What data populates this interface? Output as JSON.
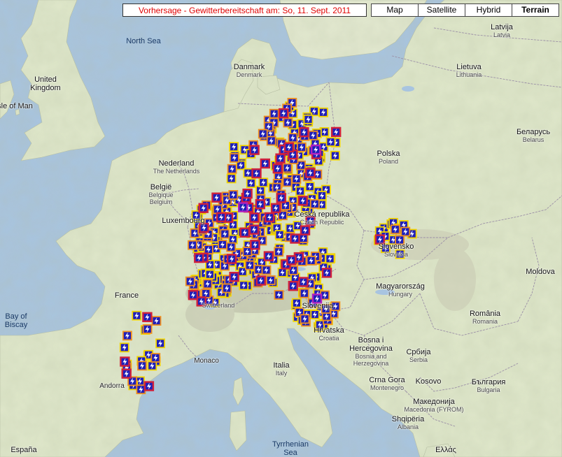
{
  "title": "Vorhersage - Gewitterbereitschaft am: So, 11. Sept. 2011",
  "map_types": [
    {
      "label": "Map",
      "active": false
    },
    {
      "label": "Satellite",
      "active": false
    },
    {
      "label": "Hybrid",
      "active": false
    },
    {
      "label": "Terrain",
      "active": true
    }
  ],
  "places": [
    {
      "name": "North Sea",
      "type": "sea"
    },
    {
      "name": "Danmark",
      "sub": "Denmark"
    },
    {
      "name": "Latvija",
      "sub": "Latvia"
    },
    {
      "name": "Lietuva",
      "sub": "Lithuania"
    },
    {
      "name": "United Kingdom"
    },
    {
      "name": "Isle of Man"
    },
    {
      "name": "Беларусь",
      "sub": "Belarus"
    },
    {
      "name": "Nederland",
      "sub": "The Netherlands"
    },
    {
      "name": "Polska",
      "sub": "Poland"
    },
    {
      "name": "België",
      "sub": "Belgique Belgium"
    },
    {
      "name": "Luxembourg"
    },
    {
      "name": "Česká republika",
      "sub": "Czech Republic"
    },
    {
      "name": "Slovensko",
      "sub": "Slovakia"
    },
    {
      "name": "Moldova"
    },
    {
      "name": "France"
    },
    {
      "name": "Magyarország",
      "sub": "Hungary"
    },
    {
      "name": "Bay of Biscay",
      "type": "sea"
    },
    {
      "name": "Switzerland"
    },
    {
      "name": "Slovenija"
    },
    {
      "name": "România",
      "sub": "Romania"
    },
    {
      "name": "Hrvatska",
      "sub": "Croatia"
    },
    {
      "name": "Bosna i Hercegovina",
      "sub": "Bosnia and Herzegovina"
    },
    {
      "name": "Србија",
      "sub": "Serbia"
    },
    {
      "name": "Monaco",
      "type": "city"
    },
    {
      "name": "Italia",
      "sub": "Italy"
    },
    {
      "name": "Andorra",
      "type": "city"
    },
    {
      "name": "Crna Gora",
      "sub": "Montenegro"
    },
    {
      "name": "Kosovo"
    },
    {
      "name": "България",
      "sub": "Bulgaria"
    },
    {
      "name": "Македонија",
      "sub": "Macedonia (FYROM)"
    },
    {
      "name": "Shqipëria",
      "sub": "Albania"
    },
    {
      "name": "España"
    },
    {
      "name": "Tyrrhenian Sea",
      "type": "sea"
    },
    {
      "name": "Ελλάς"
    }
  ],
  "marker_legend": {
    "levels": [
      "low",
      "medium",
      "high",
      "extreme"
    ],
    "colors": {
      "low": "#f2d400",
      "medium": "#f09020",
      "high": "#d0203c",
      "extreme": "#b020c0"
    },
    "symbol_color": "#1f1fb8"
  },
  "markers": {
    "low": 228,
    "medium": 120,
    "high": 52,
    "extreme": 3
  },
  "colors": {
    "water": "#a8c4e0",
    "land": "#dde6c8"
  }
}
